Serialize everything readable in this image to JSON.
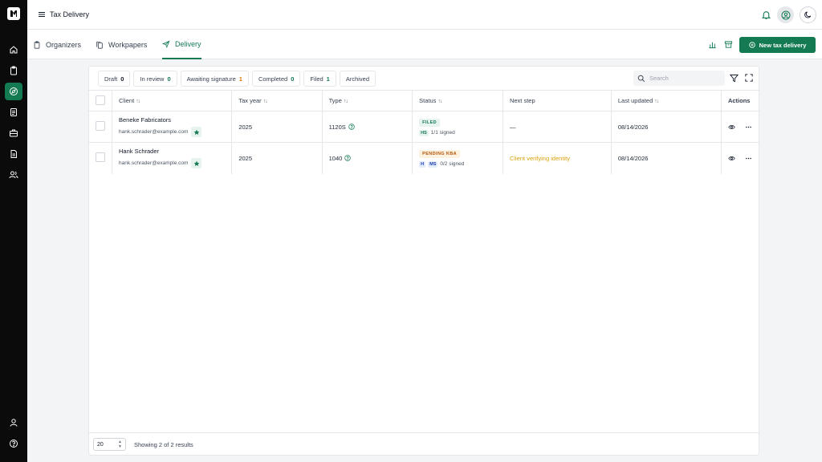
{
  "header": {
    "title": "Tax Delivery"
  },
  "module_tabs": [
    {
      "label": "Organizers"
    },
    {
      "label": "Workpapers"
    },
    {
      "label": "Delivery"
    }
  ],
  "new_button": {
    "label": "New tax delivery"
  },
  "filters": [
    {
      "label": "Draft",
      "count": "0"
    },
    {
      "label": "In review",
      "count": "0"
    },
    {
      "label": "Awaiting signature",
      "count": "1"
    },
    {
      "label": "Completed",
      "count": "0"
    },
    {
      "label": "Filed",
      "count": "1"
    },
    {
      "label": "Archived"
    }
  ],
  "search": {
    "placeholder": "Search"
  },
  "table": {
    "columns": [
      "Client",
      "Tax year",
      "Type",
      "Status",
      "Next step",
      "Last updated",
      "Actions"
    ],
    "rows": [
      {
        "client": "Beneke Fabricators",
        "email": "hank.schrader@example.com",
        "tax_year": "2025",
        "type": "1120S",
        "status": "FILED",
        "signers": [
          "HS"
        ],
        "signed": "1/1 signed",
        "next_step": "—",
        "last_updated": "08/14/2026"
      },
      {
        "client": "Hank Schrader",
        "email": "hank.schrader@example.com",
        "tax_year": "2025",
        "type": "1040",
        "status": "PENDING KBA",
        "signers": [
          "H",
          "MS"
        ],
        "signed": "0/2 signed",
        "next_step": "Client verifying identity",
        "last_updated": "08/14/2026"
      }
    ]
  },
  "footer": {
    "page_size": "20",
    "results": "Showing 2 of 2 results"
  },
  "colors": {
    "accent": "#137a52",
    "amber": "#d9a30f",
    "rail": "#0b0b0b"
  }
}
